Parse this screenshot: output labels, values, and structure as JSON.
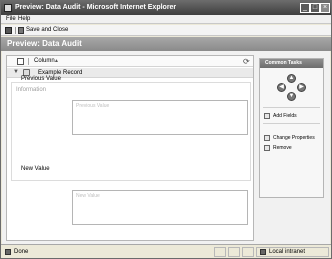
{
  "window": {
    "title": "Preview: Data Audit - Microsoft Internet Explorer",
    "controls": {
      "minimize": "_",
      "maximize": "□",
      "close": "×"
    }
  },
  "menu": {
    "file": "File",
    "help": "Help"
  },
  "toolbar": {
    "save_close_label": "Save and Close"
  },
  "header": {
    "title": "Preview: Data Audit"
  },
  "form": {
    "column_label": "Column",
    "column_sort_glyph": "▲",
    "record_label": "Example Record",
    "refresh_glyph": "⟳",
    "nav_glyph": "▼",
    "section_title": "Information",
    "fields": [
      {
        "label": "Previous Value",
        "placeholder": "Previous Value"
      },
      {
        "label": "New Value",
        "placeholder": "New Value"
      }
    ]
  },
  "common_tasks": {
    "title": "Common Tasks",
    "arrows": {
      "up": "▲",
      "left": "◀",
      "right": "▶",
      "down": "▼"
    },
    "items": [
      "Add Fields",
      "Change Properties",
      "Remove"
    ]
  },
  "status": {
    "left": "Done",
    "zone": "Local intranet"
  }
}
